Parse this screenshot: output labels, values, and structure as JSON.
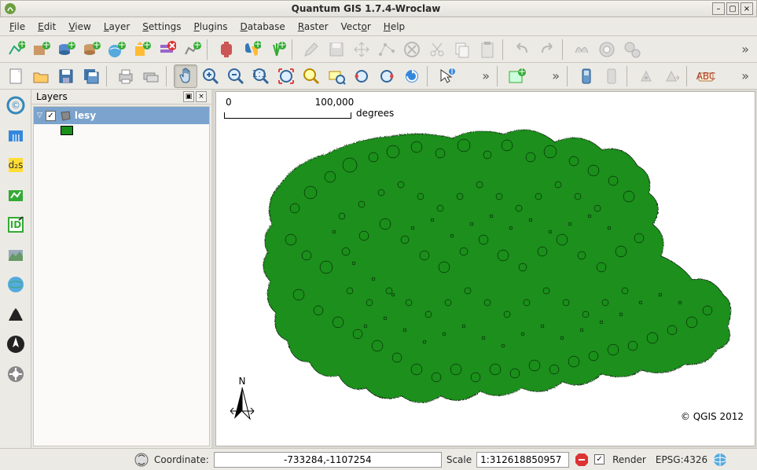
{
  "window": {
    "title": "Quantum GIS 1.7.4-Wroclaw"
  },
  "menu": {
    "file": "File",
    "edit": "Edit",
    "view": "View",
    "layer": "Layer",
    "settings": "Settings",
    "plugins": "Plugins",
    "database": "Database",
    "raster": "Raster",
    "vector": "Vector",
    "help": "Help"
  },
  "layers_panel": {
    "title": "Layers",
    "item1": "lesy"
  },
  "map": {
    "scale_min": "0",
    "scale_max": "100,000",
    "scale_units": "degrees",
    "copyright": "© QGIS 2012",
    "north": "N"
  },
  "status": {
    "coord_label": "Coordinate:",
    "coord_value": "-733284,-1107254",
    "scale_label": "Scale",
    "scale_value": "1:312618850957",
    "render_label": "Render",
    "crs": "EPSG:4326"
  }
}
